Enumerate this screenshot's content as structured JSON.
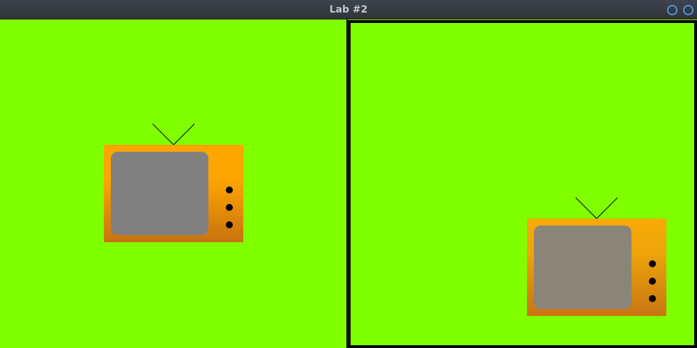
{
  "window": {
    "title": "Lab #2",
    "button_color": "#5294e2"
  },
  "colors": {
    "background": "#7fff00",
    "tv_body_top": "#ffa500",
    "tv_body_bottom": "#c8720f",
    "tv_screen": "#808080",
    "knob": "#000000"
  },
  "panes": [
    {
      "name": "left-view",
      "object": "tv",
      "knobs": 3
    },
    {
      "name": "right-view",
      "object": "tv",
      "knobs": 3,
      "bordered": true
    }
  ]
}
